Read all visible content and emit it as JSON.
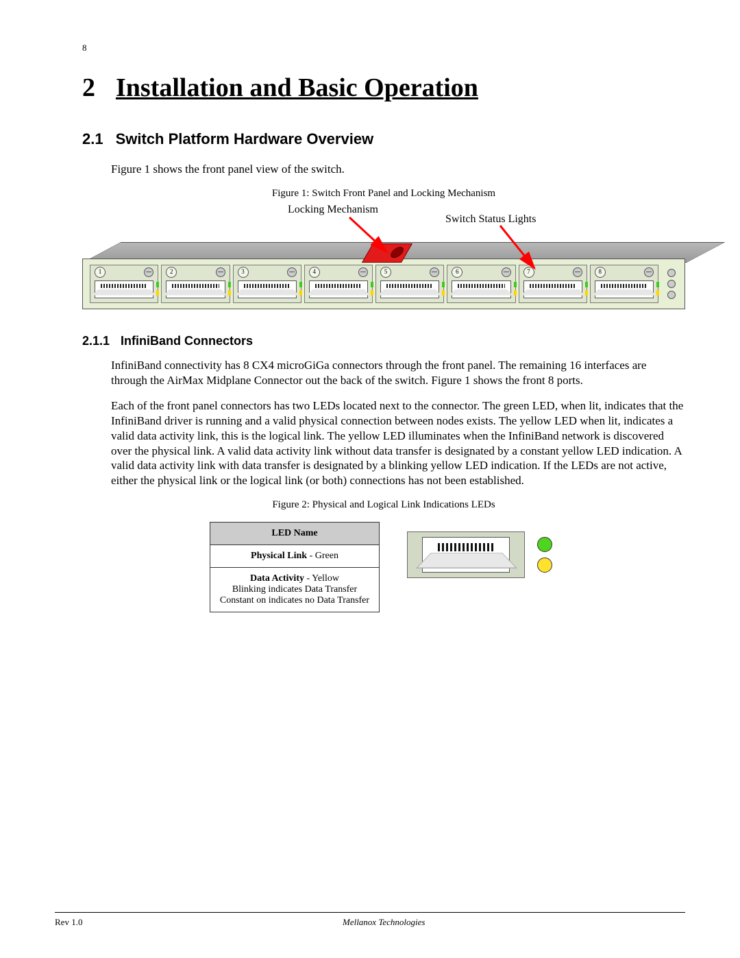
{
  "page_number": "8",
  "chapter": {
    "num": "2",
    "title": "Installation and Basic Operation"
  },
  "section": {
    "num": "2.1",
    "title": "Switch Platform Hardware Overview"
  },
  "intro_para": "Figure 1 shows the front panel view of the switch.",
  "figure1": {
    "caption": "Figure 1: Switch Front Panel and Locking Mechanism",
    "annot_locking": "Locking Mechanism",
    "annot_status": "Switch Status Lights",
    "ports": [
      "1",
      "2",
      "3",
      "4",
      "5",
      "6",
      "7",
      "8"
    ]
  },
  "subsection": {
    "num": "2.1.1",
    "title": "InfiniBand Connectors"
  },
  "para1": "InfiniBand connectivity has 8 CX4 microGiGa connectors through the front panel. The remaining 16 interfaces are through the AirMax Midplane Connector out the back of the switch. Figure 1 shows the front 8 ports.",
  "para2": "Each of the front panel connectors has two LEDs located next to the connector. The green LED, when lit, indicates that the InfiniBand driver is running and a valid physical connection between nodes exists. The yellow LED when lit, indicates a valid data activity link, this is the logical link. The yellow LED illuminates when the InfiniBand network is discovered over the physical link. A valid data activity link without data transfer is designated by a constant yellow LED indication. A valid data activity link with data transfer is designated by a blinking yellow LED indication. If the LEDs are not active, either the physical link or the logical link (or both) connections has not been established.",
  "figure2": {
    "caption": "Figure 2: Physical and Logical Link Indications LEDs",
    "table": {
      "header": "LED Name",
      "row1_label": "Physical Link",
      "row1_color": " - Green",
      "row2_label": "Data Activity",
      "row2_color": " - Yellow",
      "row2_note1": "Blinking indicates Data Transfer",
      "row2_note2": "Constant on indicates no Data Transfer"
    }
  },
  "footer": {
    "left": "Rev 1.0",
    "center": "Mellanox Technologies"
  }
}
